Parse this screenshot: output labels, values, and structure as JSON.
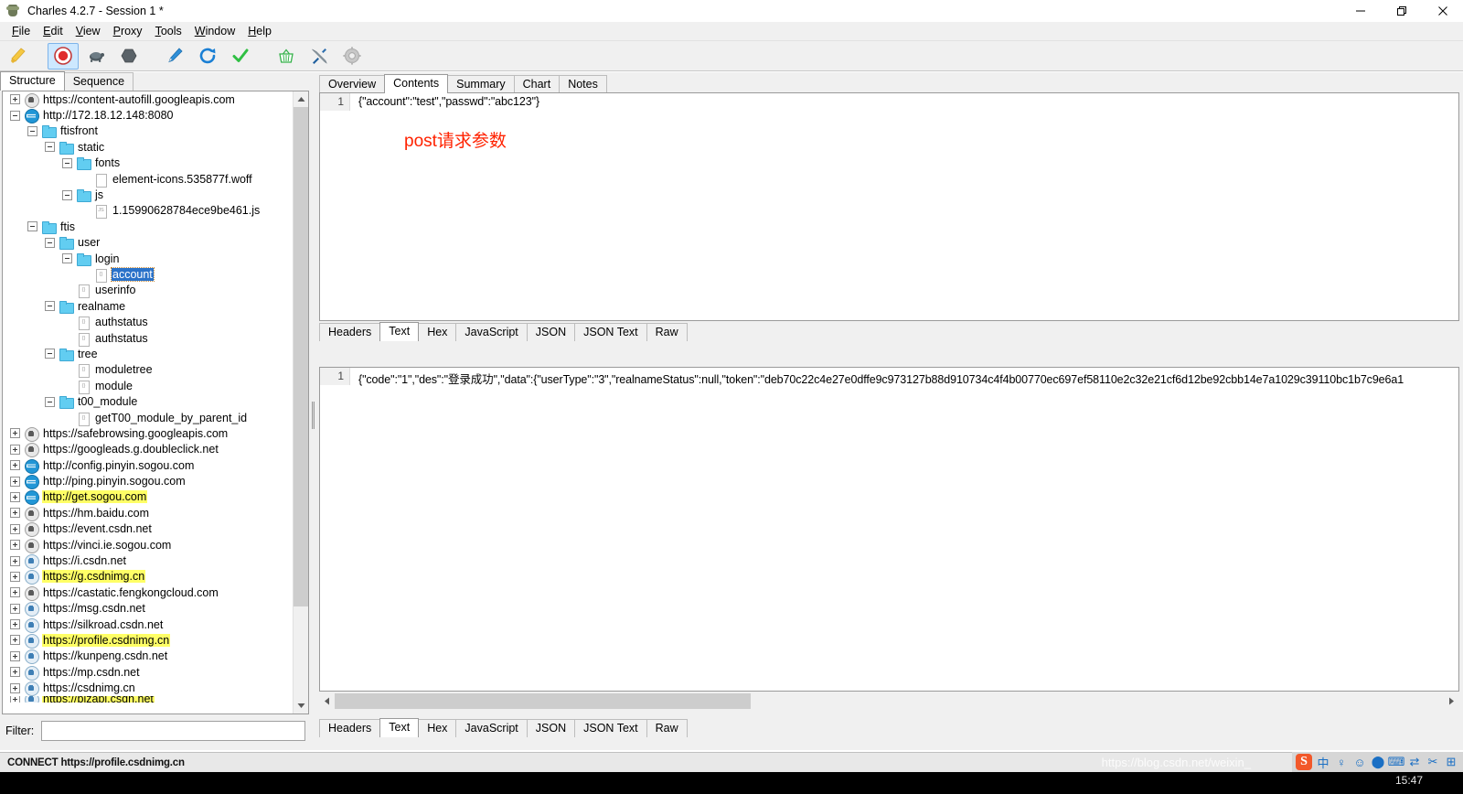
{
  "window": {
    "title": "Charles 4.2.7 - Session 1 *",
    "app_icon": "charles-bottle-icon",
    "controls": {
      "minimize": "minimize-button",
      "maximize": "maximize-button",
      "close": "close-button"
    }
  },
  "menubar": [
    {
      "label": "File",
      "mnemonic": "F"
    },
    {
      "label": "Edit",
      "mnemonic": "E"
    },
    {
      "label": "View",
      "mnemonic": "V"
    },
    {
      "label": "Proxy",
      "mnemonic": "P"
    },
    {
      "label": "Tools",
      "mnemonic": "T"
    },
    {
      "label": "Window",
      "mnemonic": "W"
    },
    {
      "label": "Help",
      "mnemonic": "H"
    }
  ],
  "toolbar": [
    {
      "name": "clear-session-button",
      "icon": "broom-icon",
      "selected": false
    },
    {
      "name": "start-stop-recording-button",
      "icon": "record-icon",
      "selected": true
    },
    {
      "name": "throttle-button",
      "icon": "turtle-icon",
      "selected": false
    },
    {
      "name": "breakpoints-button",
      "icon": "hexagon-icon",
      "selected": false
    },
    {
      "name": "compose-button",
      "icon": "pen-icon",
      "selected": false
    },
    {
      "name": "repeat-button",
      "icon": "refresh-icon",
      "selected": false
    },
    {
      "name": "validate-button",
      "icon": "checkmark-icon",
      "selected": false
    },
    {
      "name": "tools-basket-button",
      "icon": "basket-icon",
      "selected": false
    },
    {
      "name": "settings-tools-button",
      "icon": "wrench-screwdriver-icon",
      "selected": false
    },
    {
      "name": "proxy-settings-button",
      "icon": "gear-icon",
      "selected": false
    }
  ],
  "left_panel": {
    "tabs": [
      {
        "label": "Structure",
        "active": true
      },
      {
        "label": "Sequence",
        "active": false
      }
    ],
    "tree": [
      {
        "label": "https://content-autofill.googleapis.com",
        "indent": 0,
        "toggle": "plus",
        "icon": "lock-icon",
        "highlight": false,
        "selected": false
      },
      {
        "label": "http://172.18.12.148:8080",
        "indent": 0,
        "toggle": "minus",
        "icon": "globe-icon",
        "highlight": false,
        "selected": false
      },
      {
        "label": "ftisfront",
        "indent": 1,
        "toggle": "minus",
        "icon": "folder-icon",
        "highlight": false,
        "selected": false
      },
      {
        "label": "static",
        "indent": 2,
        "toggle": "minus",
        "icon": "folder-icon",
        "highlight": false,
        "selected": false
      },
      {
        "label": "fonts",
        "indent": 3,
        "toggle": "minus",
        "icon": "folder-icon",
        "highlight": false,
        "selected": false
      },
      {
        "label": "element-icons.535877f.woff",
        "indent": 4,
        "toggle": "none",
        "icon": "file-icon",
        "highlight": false,
        "selected": false
      },
      {
        "label": "js",
        "indent": 3,
        "toggle": "minus",
        "icon": "folder-icon",
        "highlight": false,
        "selected": false
      },
      {
        "label": "1.15990628784ece9be461.js",
        "indent": 4,
        "toggle": "none",
        "icon": "js-file-icon",
        "highlight": false,
        "selected": false,
        "badge": "JS"
      },
      {
        "label": "ftis",
        "indent": 1,
        "toggle": "minus",
        "icon": "folder-icon",
        "highlight": false,
        "selected": false
      },
      {
        "label": "user",
        "indent": 2,
        "toggle": "minus",
        "icon": "folder-icon",
        "highlight": false,
        "selected": false
      },
      {
        "label": "login",
        "indent": 3,
        "toggle": "minus",
        "icon": "folder-icon",
        "highlight": false,
        "selected": false
      },
      {
        "label": "account",
        "indent": 4,
        "toggle": "none",
        "icon": "json-file-icon",
        "highlight": false,
        "selected": true,
        "badge": "{}"
      },
      {
        "label": "userinfo",
        "indent": 3,
        "toggle": "none",
        "icon": "json-file-icon",
        "highlight": false,
        "selected": false,
        "badge": "{}"
      },
      {
        "label": "realname",
        "indent": 2,
        "toggle": "minus",
        "icon": "folder-icon",
        "highlight": false,
        "selected": false
      },
      {
        "label": "authstatus",
        "indent": 3,
        "toggle": "none",
        "icon": "json-file-icon",
        "highlight": false,
        "selected": false,
        "badge": "{}"
      },
      {
        "label": "authstatus",
        "indent": 3,
        "toggle": "none",
        "icon": "json-file-icon",
        "highlight": false,
        "selected": false,
        "badge": "{}"
      },
      {
        "label": "tree",
        "indent": 2,
        "toggle": "minus",
        "icon": "folder-icon",
        "highlight": false,
        "selected": false
      },
      {
        "label": "moduletree",
        "indent": 3,
        "toggle": "none",
        "icon": "json-file-icon",
        "highlight": false,
        "selected": false,
        "badge": "{}"
      },
      {
        "label": "module",
        "indent": 3,
        "toggle": "none",
        "icon": "json-file-icon",
        "highlight": false,
        "selected": false,
        "badge": "{}"
      },
      {
        "label": "t00_module",
        "indent": 2,
        "toggle": "minus",
        "icon": "folder-icon",
        "highlight": false,
        "selected": false
      },
      {
        "label": "getT00_module_by_parent_id",
        "indent": 3,
        "toggle": "none",
        "icon": "json-file-icon",
        "highlight": false,
        "selected": false,
        "badge": "{}"
      },
      {
        "label": "https://safebrowsing.googleapis.com",
        "indent": 0,
        "toggle": "plus",
        "icon": "lock-icon",
        "highlight": false,
        "selected": false
      },
      {
        "label": "https://googleads.g.doubleclick.net",
        "indent": 0,
        "toggle": "plus",
        "icon": "lock-icon",
        "highlight": false,
        "selected": false
      },
      {
        "label": "http://config.pinyin.sogou.com",
        "indent": 0,
        "toggle": "plus",
        "icon": "globe-icon",
        "highlight": false,
        "selected": false
      },
      {
        "label": "http://ping.pinyin.sogou.com",
        "indent": 0,
        "toggle": "plus",
        "icon": "globe-icon",
        "highlight": false,
        "selected": false
      },
      {
        "label": "http://get.sogou.com",
        "indent": 0,
        "toggle": "plus",
        "icon": "globe-icon",
        "highlight": true,
        "selected": false
      },
      {
        "label": "https://hm.baidu.com",
        "indent": 0,
        "toggle": "plus",
        "icon": "lock-icon",
        "highlight": false,
        "selected": false
      },
      {
        "label": "https://event.csdn.net",
        "indent": 0,
        "toggle": "plus",
        "icon": "lock-icon",
        "highlight": false,
        "selected": false
      },
      {
        "label": "https://vinci.ie.sogou.com",
        "indent": 0,
        "toggle": "plus",
        "icon": "lock-icon",
        "highlight": false,
        "selected": false
      },
      {
        "label": "https://i.csdn.net",
        "indent": 0,
        "toggle": "plus",
        "icon": "lock-blue-icon",
        "highlight": false,
        "selected": false
      },
      {
        "label": "https://g.csdnimg.cn",
        "indent": 0,
        "toggle": "plus",
        "icon": "lock-blue-icon",
        "highlight": true,
        "selected": false
      },
      {
        "label": "https://castatic.fengkongcloud.com",
        "indent": 0,
        "toggle": "plus",
        "icon": "lock-icon",
        "highlight": false,
        "selected": false
      },
      {
        "label": "https://msg.csdn.net",
        "indent": 0,
        "toggle": "plus",
        "icon": "lock-blue-icon",
        "highlight": false,
        "selected": false
      },
      {
        "label": "https://silkroad.csdn.net",
        "indent": 0,
        "toggle": "plus",
        "icon": "lock-blue-icon",
        "highlight": false,
        "selected": false
      },
      {
        "label": "https://profile.csdnimg.cn",
        "indent": 0,
        "toggle": "plus",
        "icon": "lock-blue-icon",
        "highlight": true,
        "selected": false
      },
      {
        "label": "https://kunpeng.csdn.net",
        "indent": 0,
        "toggle": "plus",
        "icon": "lock-blue-icon",
        "highlight": false,
        "selected": false
      },
      {
        "label": "https://mp.csdn.net",
        "indent": 0,
        "toggle": "plus",
        "icon": "lock-blue-icon",
        "highlight": false,
        "selected": false
      },
      {
        "label": "https://csdnimg.cn",
        "indent": 0,
        "toggle": "plus",
        "icon": "lock-blue-icon",
        "highlight": false,
        "selected": false
      },
      {
        "label": "https://bizapi.csdn.net",
        "indent": 0,
        "toggle": "plus",
        "icon": "lock-blue-icon",
        "highlight": true,
        "selected": false,
        "clipped": true
      }
    ],
    "filter": {
      "label": "Filter:",
      "value": "",
      "placeholder": ""
    }
  },
  "right_panel": {
    "top_tabs": [
      {
        "label": "Overview",
        "active": false
      },
      {
        "label": "Contents",
        "active": true
      },
      {
        "label": "Summary",
        "active": false
      },
      {
        "label": "Chart",
        "active": false
      },
      {
        "label": "Notes",
        "active": false
      }
    ],
    "request": {
      "line_number": "1",
      "body": "{\"account\":\"test\",\"passwd\":\"abc123\"}",
      "annotation": "post请求参数",
      "annotation_color": "#ff2200",
      "view_tabs": [
        {
          "label": "Headers",
          "active": false
        },
        {
          "label": "Text",
          "active": true
        },
        {
          "label": "Hex",
          "active": false
        },
        {
          "label": "JavaScript",
          "active": false
        },
        {
          "label": "JSON",
          "active": false
        },
        {
          "label": "JSON Text",
          "active": false
        },
        {
          "label": "Raw",
          "active": false
        }
      ]
    },
    "response": {
      "line_number": "1",
      "body": "{\"code\":\"1\",\"des\":\"登录成功\",\"data\":{\"userType\":\"3\",\"realnameStatus\":null,\"token\":\"deb70c22c4e27e0dffe9c973127b88d910734c4f4b00770ec697ef58110e2c32e21cf6d12be92cbb14e7a1029c39110bc1b7c9e6a1",
      "view_tabs": [
        {
          "label": "Headers",
          "active": false
        },
        {
          "label": "Text",
          "active": true
        },
        {
          "label": "Hex",
          "active": false
        },
        {
          "label": "JavaScript",
          "active": false
        },
        {
          "label": "JSON",
          "active": false
        },
        {
          "label": "JSON Text",
          "active": false
        },
        {
          "label": "Raw",
          "active": false
        }
      ]
    }
  },
  "statusbar": {
    "text": "CONNECT https://profile.csdnimg.cn"
  },
  "overlay": {
    "watermark": "https://blog.csdn.net/weixin_",
    "ime": {
      "brand": "S",
      "items": [
        "中",
        "♀",
        "☺",
        "⬤",
        "⌨",
        "⇄",
        "✂",
        "⊞"
      ]
    },
    "clock": "15:47"
  }
}
